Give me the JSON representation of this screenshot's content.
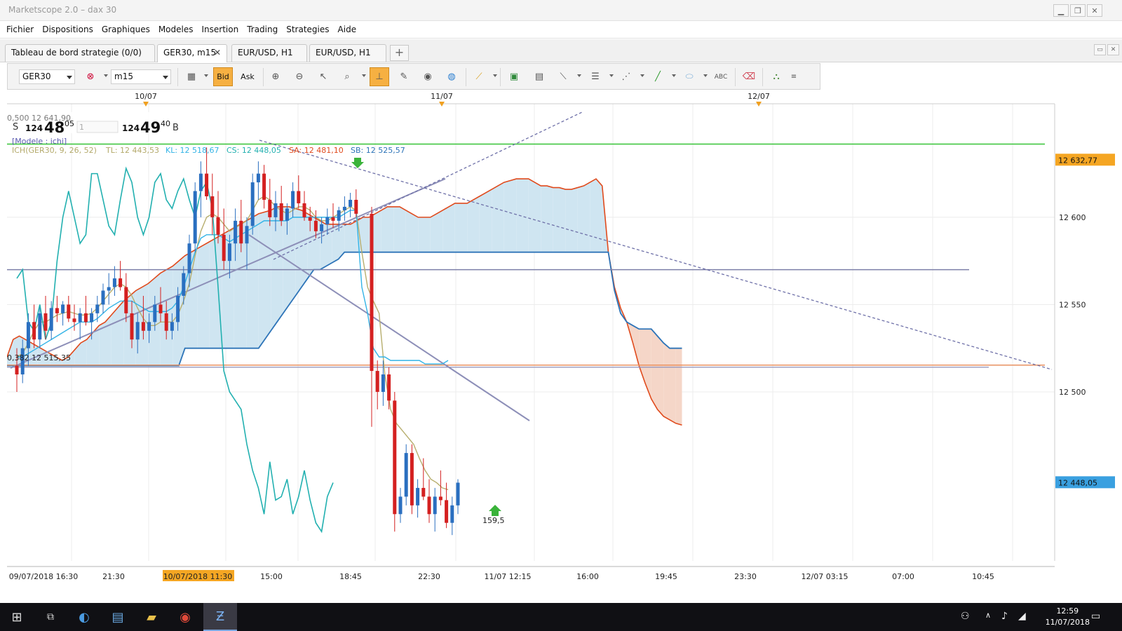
{
  "window": {
    "title": "Marketscope 2.0 – dax 30"
  },
  "menu": [
    "Fichier",
    "Dispositions",
    "Graphiques",
    "Modeles",
    "Insertion",
    "Trading",
    "Strategies",
    "Aide"
  ],
  "tabs": [
    {
      "label": "Tableau de bord strategie (0/0)",
      "active": false
    },
    {
      "label": "GER30, m15",
      "active": true,
      "closable": true
    },
    {
      "label": "EUR/USD, H1",
      "active": false
    },
    {
      "label": "EUR/USD, H1",
      "active": false
    }
  ],
  "toolbar": {
    "instrument": "GER30",
    "timeframe": "m15",
    "bid_label": "Bid",
    "ask_label": "Ask"
  },
  "quote": {
    "fib_label": "0,500 12 641,90",
    "sell_label": "S",
    "sell_big": "124",
    "sell_main": "48",
    "sell_sup": "05",
    "qty": "1",
    "buy_big": "124",
    "buy_main": "49",
    "buy_sup": "40",
    "buy_label": "B"
  },
  "indicator": {
    "model": "[Modele : ichi]",
    "name": "ICH(GER30, 9, 26, 52)",
    "tl": "TL: 12 443,53",
    "kl": "KL: 12 518,67",
    "cs": "CS: 12 448,05",
    "sa": "SA: 12 481,10",
    "sb": "SB: 12 525,57"
  },
  "fib_low_label": "0,382 12 515,35",
  "signal_label": "159,5",
  "colors": {
    "tenkan": "#b7ae6e",
    "kijun": "#32b3e6",
    "chikou": "#22b0b0",
    "senkou_a": "#e04a1c",
    "senkou_b": "#2d74b8",
    "cloud_bull": "#cfe5f1",
    "cloud_bear": "#f5d6c8",
    "candle_up": "#2a6fc0",
    "candle_down": "#d42020",
    "trend": "#8d8fb8",
    "support_green": "#35c435",
    "fib_orange": "#f0a070"
  },
  "chart_data": {
    "type": "candlestick",
    "instrument": "GER30",
    "timeframe": "m15",
    "top_date_labels": [
      "10/07",
      "11/07",
      "12/07"
    ],
    "x_tick_labels": [
      "09/07/2018 16:30",
      "21:30",
      "10/07/2018 11:30",
      "15:00",
      "18:45",
      "22:30",
      "11/07 12:15",
      "16:00",
      "19:45",
      "23:30",
      "12/07 03:15",
      "07:00",
      "10:45"
    ],
    "y_tick_labels": [
      "12 600",
      "12 550",
      "12 500"
    ],
    "y_range": [
      12400,
      12665
    ],
    "price_tags": [
      {
        "value": 12632.77,
        "label": "12 632,77",
        "color": "#f5a623"
      },
      {
        "value": 12448.05,
        "label": "12 448,05",
        "color": "#3aa0e0"
      }
    ],
    "horizontal_lines": [
      {
        "value": 12641.9,
        "color": "#35c435"
      },
      {
        "value": 12570,
        "color": "#7d7fa8"
      },
      {
        "value": 12515.35,
        "color": "#e89060"
      }
    ],
    "candles": [
      [
        12515,
        12525,
        12500,
        12510
      ],
      [
        12510,
        12530,
        12505,
        12525
      ],
      [
        12525,
        12545,
        12515,
        12540
      ],
      [
        12540,
        12550,
        12525,
        12530
      ],
      [
        12530,
        12548,
        12525,
        12545
      ],
      [
        12545,
        12555,
        12530,
        12535
      ],
      [
        12535,
        12552,
        12530,
        12548
      ],
      [
        12548,
        12555,
        12540,
        12545
      ],
      [
        12545,
        12552,
        12538,
        12550
      ],
      [
        12550,
        12555,
        12540,
        12542
      ],
      [
        12542,
        12550,
        12535,
        12540
      ],
      [
        12540,
        12548,
        12530,
        12545
      ],
      [
        12545,
        12555,
        12538,
        12540
      ],
      [
        12540,
        12548,
        12530,
        12545
      ],
      [
        12545,
        12555,
        12540,
        12550
      ],
      [
        12550,
        12562,
        12545,
        12558
      ],
      [
        12558,
        12568,
        12550,
        12560
      ],
      [
        12560,
        12572,
        12555,
        12565
      ],
      [
        12565,
        12575,
        12558,
        12560
      ],
      [
        12560,
        12568,
        12540,
        12545
      ],
      [
        12545,
        12552,
        12525,
        12530
      ],
      [
        12530,
        12545,
        12522,
        12540
      ],
      [
        12540,
        12555,
        12530,
        12535
      ],
      [
        12535,
        12545,
        12528,
        12540
      ],
      [
        12540,
        12555,
        12535,
        12550
      ],
      [
        12550,
        12560,
        12540,
        12545
      ],
      [
        12545,
        12552,
        12530,
        12535
      ],
      [
        12535,
        12545,
        12530,
        12540
      ],
      [
        12540,
        12560,
        12535,
        12555
      ],
      [
        12555,
        12572,
        12550,
        12568
      ],
      [
        12568,
        12590,
        12560,
        12585
      ],
      [
        12585,
        12620,
        12580,
        12615
      ],
      [
        12615,
        12632,
        12600,
        12625
      ],
      [
        12625,
        12640,
        12610,
        12612
      ],
      [
        12612,
        12625,
        12590,
        12600
      ],
      [
        12600,
        12615,
        12585,
        12590
      ],
      [
        12590,
        12605,
        12570,
        12575
      ],
      [
        12575,
        12590,
        12565,
        12585
      ],
      [
        12585,
        12605,
        12575,
        12598
      ],
      [
        12598,
        12610,
        12580,
        12585
      ],
      [
        12585,
        12600,
        12570,
        12595
      ],
      [
        12595,
        12625,
        12590,
        12620
      ],
      [
        12620,
        12632,
        12610,
        12625
      ],
      [
        12625,
        12630,
        12605,
        12610
      ],
      [
        12610,
        12622,
        12595,
        12600
      ],
      [
        12600,
        12615,
        12592,
        12608
      ],
      [
        12608,
        12618,
        12595,
        12598
      ],
      [
        12598,
        12608,
        12590,
        12605
      ],
      [
        12605,
        12620,
        12600,
        12615
      ],
      [
        12615,
        12624,
        12605,
        12608
      ],
      [
        12608,
        12615,
        12598,
        12600
      ],
      [
        12600,
        12606,
        12592,
        12598
      ],
      [
        12598,
        12604,
        12588,
        12592
      ],
      [
        12592,
        12600,
        12585,
        12596
      ],
      [
        12596,
        12605,
        12590,
        12600
      ],
      [
        12600,
        12608,
        12594,
        12598
      ],
      [
        12598,
        12606,
        12592,
        12604
      ],
      [
        12604,
        12612,
        12598,
        12606
      ],
      [
        12606,
        12614,
        12600,
        12610
      ],
      [
        12610,
        12616,
        12600,
        12602
      ],
      [
        12602,
        12606,
        12480,
        12512
      ],
      [
        12512,
        12518,
        12490,
        12500
      ],
      [
        12500,
        12518,
        12492,
        12510
      ],
      [
        12510,
        12514,
        12490,
        12495
      ],
      [
        12495,
        12500,
        12420,
        12430
      ],
      [
        12430,
        12445,
        12425,
        12440
      ],
      [
        12440,
        12470,
        12435,
        12465
      ],
      [
        12465,
        12470,
        12430,
        12435
      ],
      [
        12435,
        12450,
        12428,
        12445
      ],
      [
        12445,
        12462,
        12438,
        12440
      ],
      [
        12440,
        12450,
        12425,
        12430
      ],
      [
        12430,
        12445,
        12420,
        12440
      ],
      [
        12440,
        12455,
        12435,
        12438
      ],
      [
        12438,
        12448,
        12422,
        12425
      ],
      [
        12425,
        12440,
        12418,
        12435
      ],
      [
        12435,
        12450,
        12430,
        12448
      ]
    ]
  }
}
